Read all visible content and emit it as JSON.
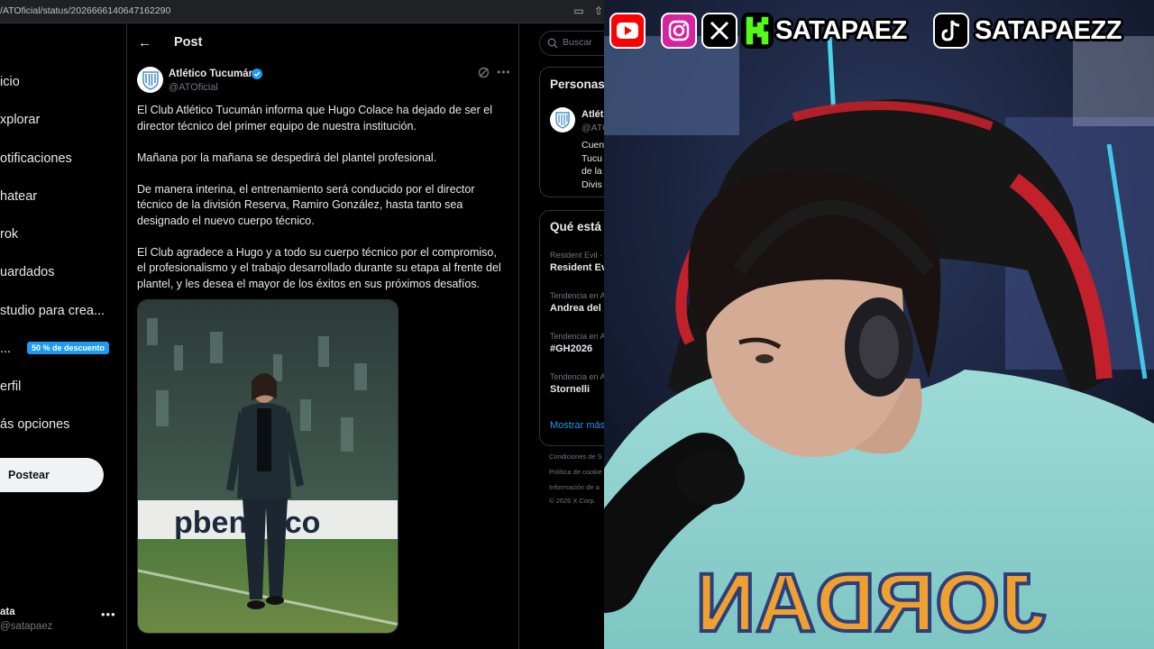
{
  "browser": {
    "url": "/ATOficial/status/2026666140647162290"
  },
  "nav": {
    "items": [
      "icio",
      "xplorar",
      "otificaciones",
      "hatear",
      "rok",
      "uardados",
      "studio para crea...",
      "...",
      "erfil",
      "ás opciones"
    ],
    "premium_badge": "50 % de descuento",
    "post_button": "Postear",
    "account_name": "ata",
    "account_handle": "@satapaez"
  },
  "post": {
    "header": "Post",
    "author_name": "Atlético Tucumán",
    "author_handle": "@ATOficial",
    "paragraphs": [
      "El Club Atlético Tucumán informa que Hugo Colace ha dejado de ser el director técnico del primer equipo de nuestra institución.",
      "Mañana por la mañana se despedirá del plantel profesional.",
      "De manera interina, el entrenamiento será conducido por el director técnico de la división Reserva, Ramiro González, hasta tanto sea designado el nuevo cuerpo técnico.",
      "El Club agradece a Hugo y a todo su cuerpo técnico por el compromiso, el profesionalismo y el trabajo desarrollado durante su etapa al frente del plantel, y les desea el mayor de los éxitos en sus próximos desafíos."
    ],
    "image_board_text": "pbentifico"
  },
  "sidebar": {
    "search_placeholder": "Buscar",
    "people_title": "Personas",
    "people_name": "Atlét",
    "people_handle": "@ATO",
    "people_bio": [
      "Cuen",
      "Tucu",
      "de la",
      "Divis"
    ],
    "trends_title": "Qué está",
    "trends": [
      {
        "context": "Resident Evil · ",
        "name": "Resident Ev"
      },
      {
        "context": "Tendencia en A",
        "name": "Andrea del"
      },
      {
        "context": "Tendencia en A",
        "name": "#GH2026"
      },
      {
        "context": "Tendencia en A",
        "name": "Stornelli"
      }
    ],
    "show_more": "Mostrar más",
    "footer": [
      "Condiciones de S",
      "Política de cookie",
      "Información de a",
      "© 2026 X Corp."
    ]
  },
  "overlay": {
    "handle_1": "SATAPAEZ",
    "handle_2": "SATAPAEZZ",
    "icons": [
      "youtube-icon",
      "instagram-icon",
      "x-icon",
      "kick-icon",
      "tiktok-icon"
    ]
  },
  "colors": {
    "x_blue": "#1d9bf0",
    "border": "#2f3336",
    "muted_text": "#71767b",
    "shirt": "#8fd3d0",
    "shirt_text": "#f0a030"
  }
}
